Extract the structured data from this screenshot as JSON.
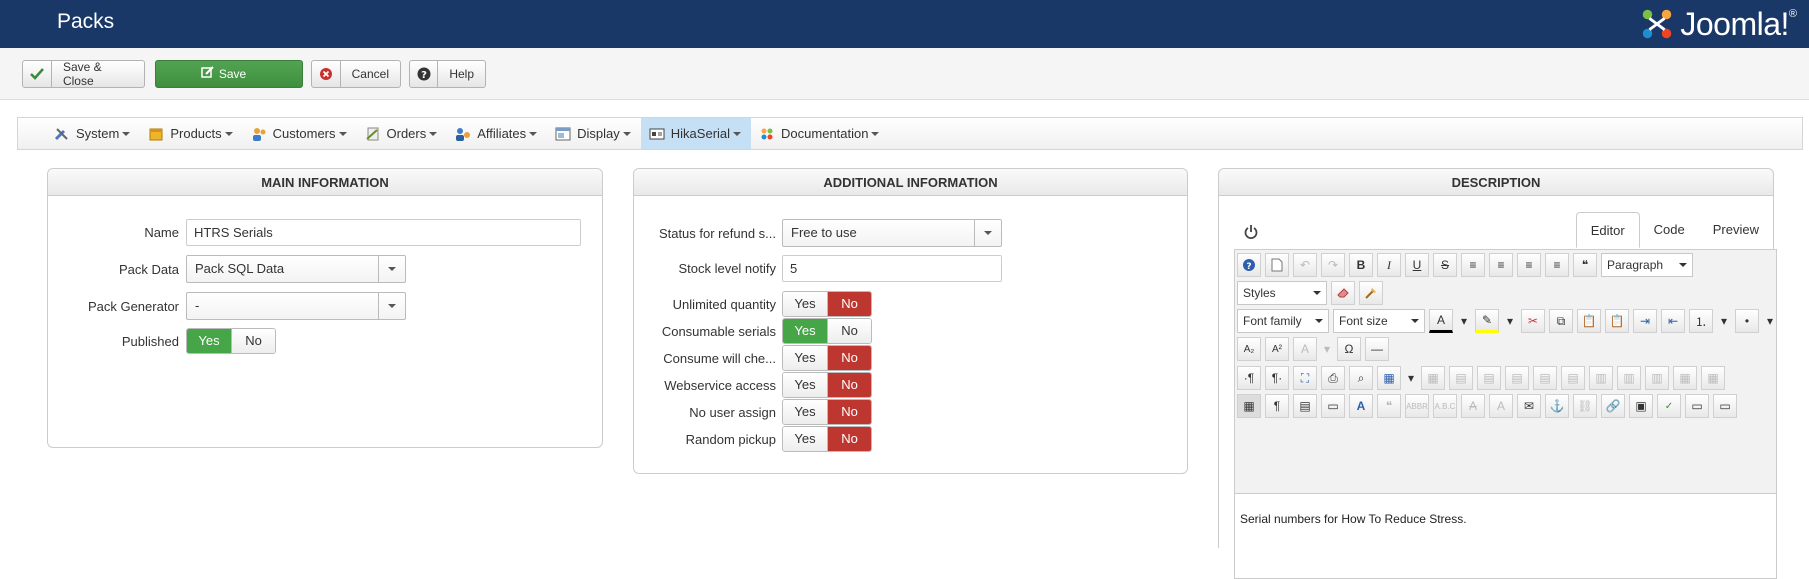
{
  "header": {
    "title": "Packs",
    "logo_text": "Joomla!",
    "logo_reg": "®"
  },
  "toolbar": {
    "save_close": "Save & Close",
    "save": "Save",
    "cancel": "Cancel",
    "help": "Help"
  },
  "menu": {
    "items": [
      {
        "label": "System",
        "icon": "wrench-icon"
      },
      {
        "label": "Products",
        "icon": "box-icon"
      },
      {
        "label": "Customers",
        "icon": "users-icon"
      },
      {
        "label": "Orders",
        "icon": "orders-icon"
      },
      {
        "label": "Affiliates",
        "icon": "affiliates-icon"
      },
      {
        "label": "Display",
        "icon": "display-icon"
      },
      {
        "label": "HikaSerial",
        "icon": "serial-icon"
      },
      {
        "label": "Documentation",
        "icon": "documentation-icon"
      }
    ],
    "active": "HikaSerial"
  },
  "main": {
    "title": "MAIN INFORMATION",
    "name_label": "Name",
    "name_value": "HTRS Serials",
    "pack_data_label": "Pack Data",
    "pack_data_value": "Pack SQL Data",
    "pack_generator_label": "Pack Generator",
    "pack_generator_value": "-",
    "published_label": "Published",
    "published_value": "Yes"
  },
  "additional": {
    "title": "ADDITIONAL INFORMATION",
    "status_label": "Status for refund s...",
    "status_value": "Free to use",
    "stock_label": "Stock level notify",
    "stock_value": "5",
    "toggles": [
      {
        "label": "Unlimited quantity",
        "value": "No"
      },
      {
        "label": "Consumable serials",
        "value": "Yes"
      },
      {
        "label": "Consume will che...",
        "value": "No"
      },
      {
        "label": "Webservice access",
        "value": "No"
      },
      {
        "label": "No user assign",
        "value": "No"
      },
      {
        "label": "Random pickup",
        "value": "No"
      }
    ]
  },
  "yes_label": "Yes",
  "no_label": "No",
  "description": {
    "title": "DESCRIPTION",
    "tabs": [
      "Editor",
      "Code",
      "Preview"
    ],
    "active_tab": "Editor",
    "format_value": "Paragraph",
    "styles_value": "Styles",
    "font_family_value": "Font family",
    "font_size_value": "Font size",
    "content": "Serial numbers for How To Reduce Stress."
  },
  "colors": {
    "header": "#1a3867",
    "green": "#46a546",
    "red": "#bd362f",
    "menu_active": "#c5dff5"
  }
}
